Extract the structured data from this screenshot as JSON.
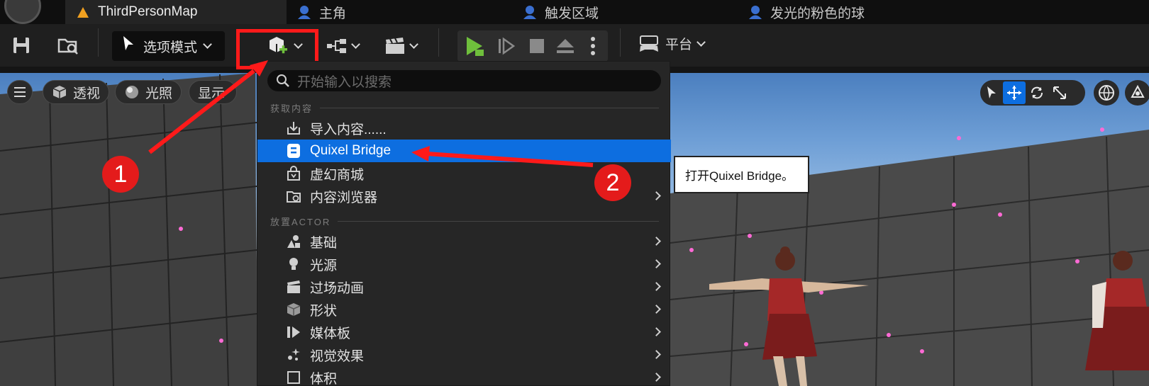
{
  "tabs": [
    {
      "label": "ThirdPersonMap",
      "icon": "level-icon"
    },
    {
      "label": "主角",
      "icon": "blueprint-icon"
    },
    {
      "label": "触发区域",
      "icon": "blueprint-icon"
    },
    {
      "label": "发光的粉色的球",
      "icon": "blueprint-icon"
    }
  ],
  "toolbar": {
    "mode_label": "选项模式",
    "platform_label": "平台"
  },
  "viewport": {
    "perspective_label": "透视",
    "lighting_label": "光照",
    "show_label": "显示"
  },
  "menu": {
    "search_placeholder": "开始输入以搜索",
    "section_get_content": "获取内容",
    "section_place_actor": "放置ACTOR",
    "items": [
      {
        "label": "导入内容......",
        "icon": "import-icon",
        "submenu": false
      },
      {
        "label": "Quixel Bridge",
        "icon": "bridge-icon",
        "submenu": false,
        "selected": true
      },
      {
        "label": "虚幻商城",
        "icon": "marketplace-icon",
        "submenu": false
      },
      {
        "label": "内容浏览器",
        "icon": "content-browser-icon",
        "submenu": true
      },
      {
        "label": "基础",
        "icon": "basic-icon",
        "submenu": true
      },
      {
        "label": "光源",
        "icon": "light-icon",
        "submenu": true
      },
      {
        "label": "过场动画",
        "icon": "cinematic-icon",
        "submenu": true
      },
      {
        "label": "形状",
        "icon": "shape-icon",
        "submenu": true
      },
      {
        "label": "媒体板",
        "icon": "media-icon",
        "submenu": true
      },
      {
        "label": "视觉效果",
        "icon": "vfx-icon",
        "submenu": true
      },
      {
        "label": "体积",
        "icon": "volume-icon",
        "submenu": true
      }
    ]
  },
  "tooltip": "打开Quixel Bridge。",
  "annotations": [
    "1",
    "2"
  ],
  "colors": {
    "accent": "#0d6ee0",
    "annotation": "#e41b1b",
    "play": "#6fbf3c"
  }
}
